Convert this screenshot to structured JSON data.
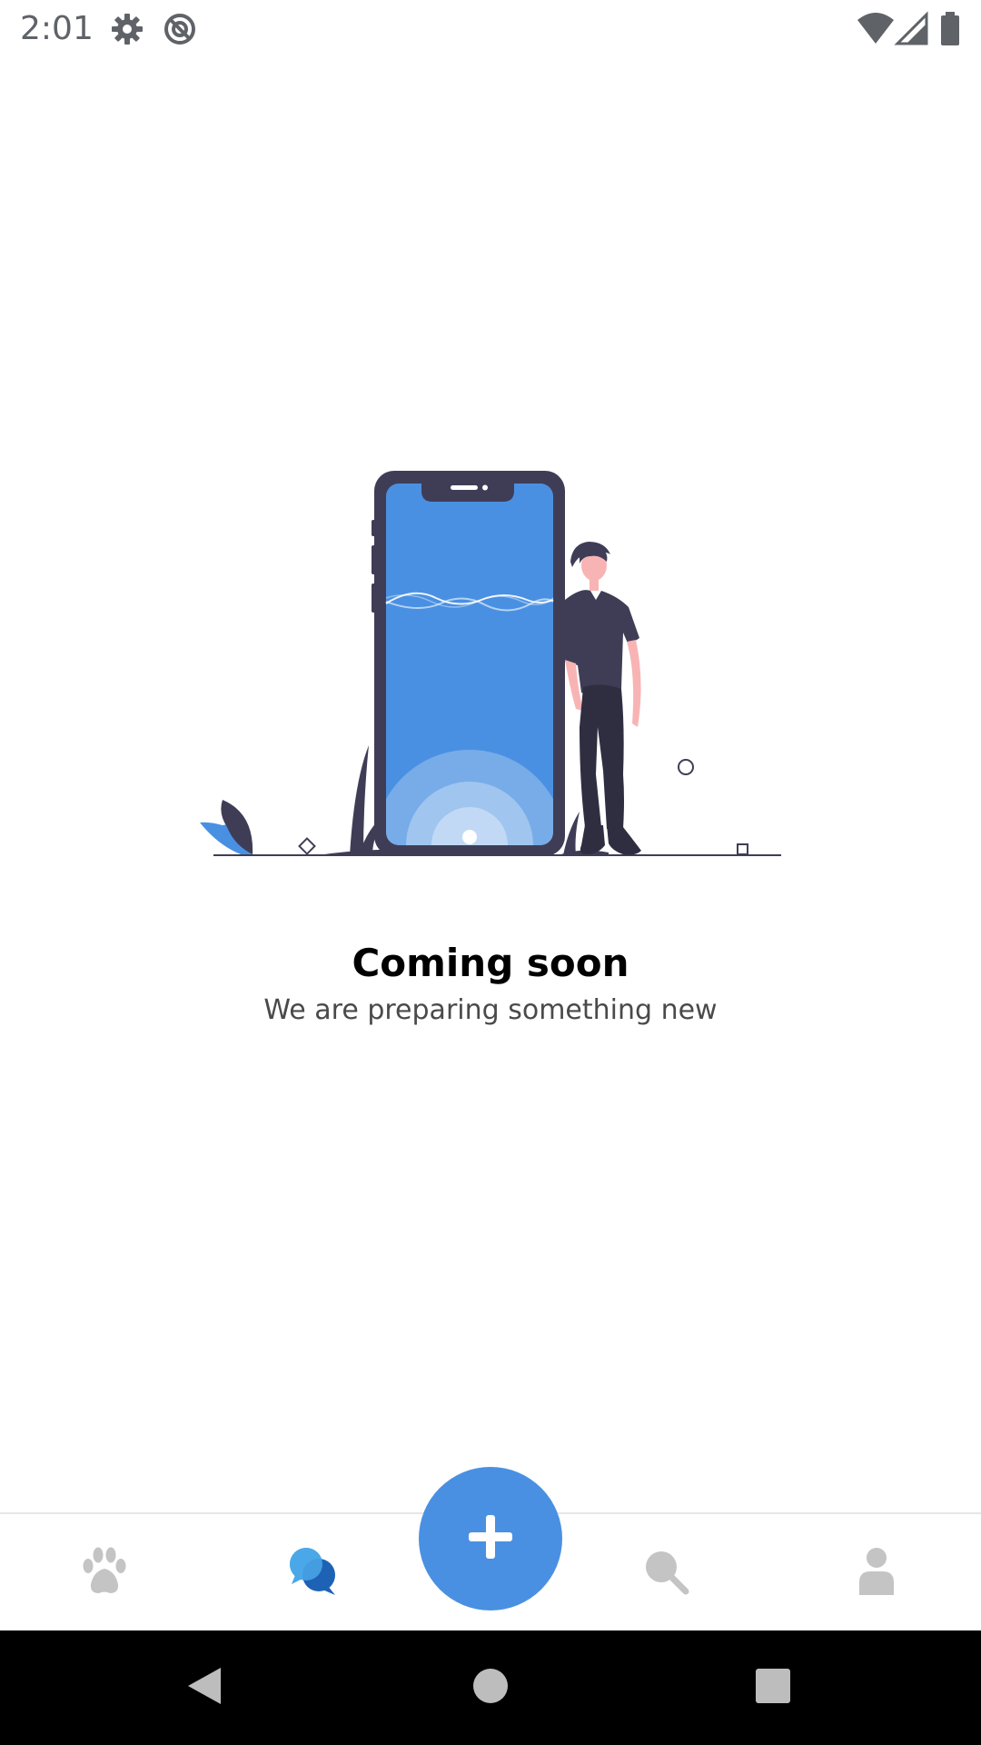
{
  "status_bar": {
    "time": "2:01",
    "icons": [
      "gear-icon",
      "no-sync-icon",
      "wifi-icon",
      "signal-icon",
      "battery-icon"
    ]
  },
  "illustration": {
    "description_icon": "coming-soon-illustration-icon"
  },
  "empty_state": {
    "title": "Coming soon",
    "subtitle": "We are preparing something new"
  },
  "bottom_nav": {
    "items": [
      {
        "icon": "paw-icon",
        "active": false
      },
      {
        "icon": "chat-bubbles-icon",
        "active": true
      },
      {
        "icon": "search-icon",
        "active": false
      },
      {
        "icon": "person-icon",
        "active": false
      }
    ],
    "fab_icon": "plus-icon"
  },
  "system_nav": {
    "buttons": [
      "back-icon",
      "home-icon",
      "recents-icon"
    ]
  },
  "colors": {
    "accent": "#4a90e2",
    "inactive_icon": "#c4c4c4",
    "illustration_dark": "#3f3d56",
    "skin": "#f8b4b4"
  }
}
